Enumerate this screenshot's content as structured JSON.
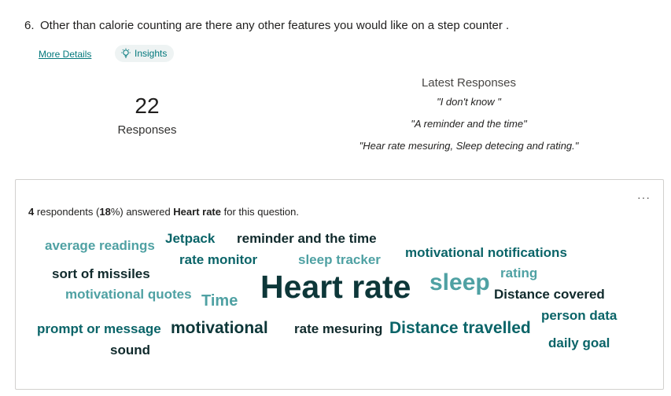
{
  "question": {
    "number": "6.",
    "text": "Other than calorie counting are there any other features you would like on a step counter ."
  },
  "actions": {
    "more_details": "More Details",
    "insights": "Insights",
    "insights_icon": "lightbulb-icon"
  },
  "stats": {
    "count": "22",
    "count_label": "Responses"
  },
  "latest": {
    "title": "Latest Responses",
    "responses": [
      "\"I don't know \"",
      "\"A reminder and the time\"",
      "\"Hear rate mesuring, Sleep detecing and rating.\""
    ]
  },
  "card": {
    "more_icon": "more-options-icon",
    "summary": {
      "count": "4",
      "pre": " respondents (",
      "percent": "18",
      "mid": "%) answered ",
      "keyword": "Heart rate",
      "post": " for this question."
    }
  },
  "word_cloud": [
    {
      "text": "average readings"
    },
    {
      "text": "Jetpack"
    },
    {
      "text": "reminder and the time"
    },
    {
      "text": "rate monitor"
    },
    {
      "text": "sleep tracker"
    },
    {
      "text": "motivational notifications"
    },
    {
      "text": "sort of missiles"
    },
    {
      "text": "Heart rate"
    },
    {
      "text": "sleep"
    },
    {
      "text": "rating"
    },
    {
      "text": "motivational quotes"
    },
    {
      "text": "Time"
    },
    {
      "text": "Distance covered"
    },
    {
      "text": "person data"
    },
    {
      "text": "prompt or message"
    },
    {
      "text": "motivational"
    },
    {
      "text": "rate mesuring"
    },
    {
      "text": "Distance travelled"
    },
    {
      "text": "daily goal"
    },
    {
      "text": "sound"
    }
  ],
  "colors": {
    "accent": "#03787c",
    "word_light": "#4fa1a3",
    "word_mid": "#0a6468",
    "word_dark": "#0d3739"
  }
}
